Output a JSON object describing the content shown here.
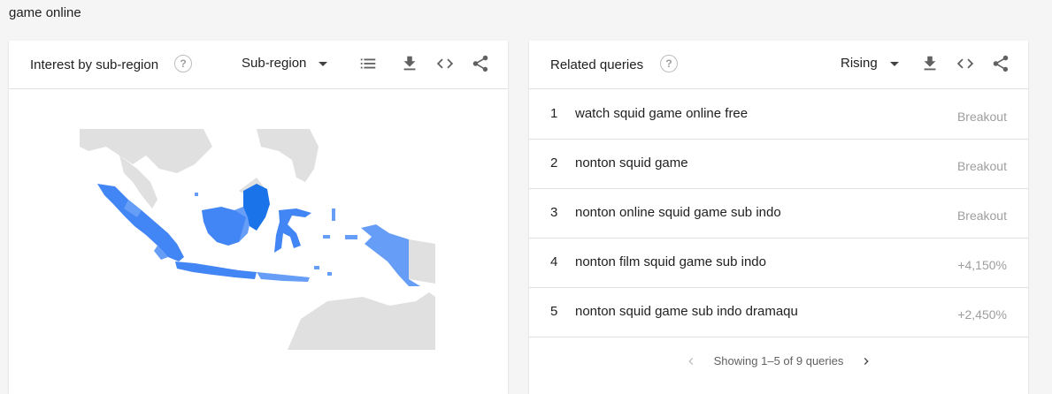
{
  "search_term": "game online",
  "left_card": {
    "title": "Interest by sub-region",
    "dropdown_label": "Sub-region",
    "icons": [
      "help-icon",
      "list-icon",
      "download-icon",
      "embed-icon",
      "share-icon"
    ],
    "map_colors": {
      "land": "#e0e0e0",
      "light": "#669df6",
      "mid": "#4285f4",
      "dark": "#1a73e8"
    }
  },
  "right_card": {
    "title": "Related queries",
    "dropdown_label": "Rising",
    "icons": [
      "help-icon",
      "download-icon",
      "embed-icon",
      "share-icon"
    ],
    "queries": [
      {
        "rank": "1",
        "text": "watch squid game online free",
        "value": "Breakout"
      },
      {
        "rank": "2",
        "text": "nonton squid game",
        "value": "Breakout"
      },
      {
        "rank": "3",
        "text": "nonton online squid game sub indo",
        "value": "Breakout"
      },
      {
        "rank": "4",
        "text": "nonton film squid game sub indo",
        "value": "+4,150%"
      },
      {
        "rank": "5",
        "text": "nonton squid game sub indo dramaqu",
        "value": "+2,450%"
      }
    ],
    "pager_text": "Showing 1–5 of 9 queries"
  }
}
